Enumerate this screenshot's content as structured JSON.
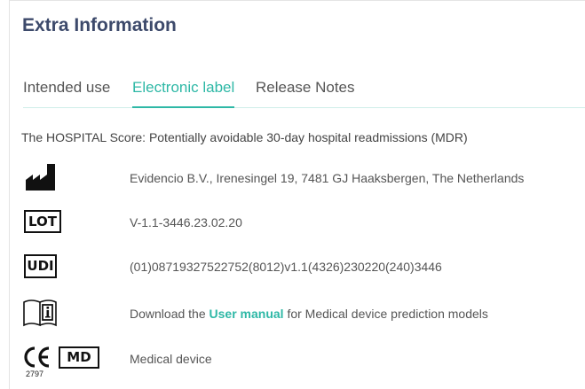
{
  "header": {
    "title": "Extra Information"
  },
  "tabs": [
    {
      "label": "Intended use",
      "active": false
    },
    {
      "label": "Electronic label",
      "active": true
    },
    {
      "label": "Release Notes",
      "active": false
    }
  ],
  "description": "The HOSPITAL Score: Potentially avoidable 30-day hospital readmissions (MDR)",
  "manufacturer": {
    "icon": "factory-icon",
    "text": "Evidencio B.V., Irenesingel 19, 7481 GJ Haaksbergen, The Netherlands"
  },
  "lot": {
    "symbol": "LOT",
    "text": "V-1.1-3446.23.02.20"
  },
  "udi": {
    "symbol": "UDI",
    "text": "(01)08719327522752(8012)v1.1(4326)230220(240)3446"
  },
  "manual": {
    "icon": "instructions-info-icon",
    "prefix": "Download the ",
    "link": "User manual",
    "suffix": " for Medical device prediction models"
  },
  "ce": {
    "mark": "CE",
    "number": "2797",
    "md_symbol": "MD",
    "text": "Medical device"
  },
  "colors": {
    "accent": "#2eb8a6",
    "title": "#3d4a6b",
    "text": "#555555"
  }
}
